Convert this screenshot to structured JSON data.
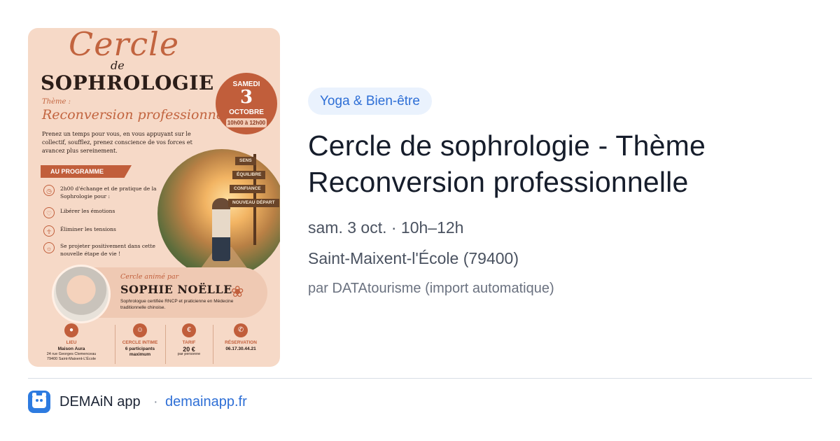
{
  "poster": {
    "title_script": "Cercle",
    "title_de": "de",
    "title_main": "SOPHROLOGIE",
    "theme_label": "Thème :",
    "theme": "Reconversion professionnelle",
    "intro": "Prenez un temps pour vous, en vous appuyant sur le collectif, soufflez, prenez conscience de vos forces et avancez plus sereinement.",
    "date_day": "SAMEDI",
    "date_num": "3",
    "date_month": "OCTOBRE",
    "date_time": "10h00 à 12h00",
    "program_label": "AU PROGRAMME",
    "program_items": [
      "2h00 d'échange et de pratique de la Sophrologie pour :",
      "Libérer les émotions",
      "Éliminer les tensions",
      "Se projeter positivement dans cette nouvelle étape de vie !"
    ],
    "signs": [
      "SENS",
      "ÉQUILIBRE",
      "CONFIANCE",
      "NOUVEAU DÉPART"
    ],
    "animator_label": "Cercle animé par",
    "animator_name": "SOPHIE NOËLLE",
    "animator_cred": "Sophrologue certifiée RNCP et praticienne en Médecine traditionnelle chinoise.",
    "footer": {
      "lieu_label": "LIEU",
      "lieu_value": "Maison Aura",
      "lieu_addr1": "24 rue Georges Clemenceau",
      "lieu_addr2": "79400 Saint-Maixent-L'École",
      "cercle_label": "CERCLE INTIME",
      "cercle_value": "6 participants maximum",
      "tarif_label": "TARIF",
      "tarif_value": "20 €",
      "tarif_sub": "par personne",
      "resa_label": "RÉSERVATION",
      "resa_value": "06.17.30.44.21"
    }
  },
  "event": {
    "category": "Yoga & Bien-être",
    "title": "Cercle de sophrologie - Thème Reconversion professionnelle",
    "when": "sam. 3 oct. · 10h–12h",
    "where": "Saint-Maixent-l'École (79400)",
    "source": "par DATAtourisme (import automatique)"
  },
  "footer": {
    "app_name": "DEMAiN app",
    "separator": "·",
    "url": "demainapp.fr"
  },
  "colors": {
    "accent": "#2e6fd6",
    "poster_bg": "#f6d9c7",
    "poster_accent": "#c15e3b"
  }
}
